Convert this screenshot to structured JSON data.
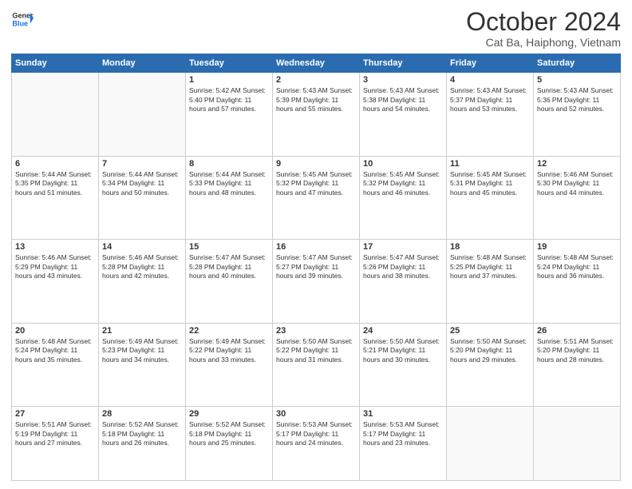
{
  "header": {
    "logo_general": "General",
    "logo_blue": "Blue",
    "month": "October 2024",
    "location": "Cat Ba, Haiphong, Vietnam"
  },
  "weekdays": [
    "Sunday",
    "Monday",
    "Tuesday",
    "Wednesday",
    "Thursday",
    "Friday",
    "Saturday"
  ],
  "weeks": [
    [
      {
        "day": "",
        "content": ""
      },
      {
        "day": "",
        "content": ""
      },
      {
        "day": "1",
        "content": "Sunrise: 5:42 AM\nSunset: 5:40 PM\nDaylight: 11 hours and 57 minutes."
      },
      {
        "day": "2",
        "content": "Sunrise: 5:43 AM\nSunset: 5:39 PM\nDaylight: 11 hours and 55 minutes."
      },
      {
        "day": "3",
        "content": "Sunrise: 5:43 AM\nSunset: 5:38 PM\nDaylight: 11 hours and 54 minutes."
      },
      {
        "day": "4",
        "content": "Sunrise: 5:43 AM\nSunset: 5:37 PM\nDaylight: 11 hours and 53 minutes."
      },
      {
        "day": "5",
        "content": "Sunrise: 5:43 AM\nSunset: 5:36 PM\nDaylight: 11 hours and 52 minutes."
      }
    ],
    [
      {
        "day": "6",
        "content": "Sunrise: 5:44 AM\nSunset: 5:35 PM\nDaylight: 11 hours and 51 minutes."
      },
      {
        "day": "7",
        "content": "Sunrise: 5:44 AM\nSunset: 5:34 PM\nDaylight: 11 hours and 50 minutes."
      },
      {
        "day": "8",
        "content": "Sunrise: 5:44 AM\nSunset: 5:33 PM\nDaylight: 11 hours and 48 minutes."
      },
      {
        "day": "9",
        "content": "Sunrise: 5:45 AM\nSunset: 5:32 PM\nDaylight: 11 hours and 47 minutes."
      },
      {
        "day": "10",
        "content": "Sunrise: 5:45 AM\nSunset: 5:32 PM\nDaylight: 11 hours and 46 minutes."
      },
      {
        "day": "11",
        "content": "Sunrise: 5:45 AM\nSunset: 5:31 PM\nDaylight: 11 hours and 45 minutes."
      },
      {
        "day": "12",
        "content": "Sunrise: 5:46 AM\nSunset: 5:30 PM\nDaylight: 11 hours and 44 minutes."
      }
    ],
    [
      {
        "day": "13",
        "content": "Sunrise: 5:46 AM\nSunset: 5:29 PM\nDaylight: 11 hours and 43 minutes."
      },
      {
        "day": "14",
        "content": "Sunrise: 5:46 AM\nSunset: 5:28 PM\nDaylight: 11 hours and 42 minutes."
      },
      {
        "day": "15",
        "content": "Sunrise: 5:47 AM\nSunset: 5:28 PM\nDaylight: 11 hours and 40 minutes."
      },
      {
        "day": "16",
        "content": "Sunrise: 5:47 AM\nSunset: 5:27 PM\nDaylight: 11 hours and 39 minutes."
      },
      {
        "day": "17",
        "content": "Sunrise: 5:47 AM\nSunset: 5:26 PM\nDaylight: 11 hours and 38 minutes."
      },
      {
        "day": "18",
        "content": "Sunrise: 5:48 AM\nSunset: 5:25 PM\nDaylight: 11 hours and 37 minutes."
      },
      {
        "day": "19",
        "content": "Sunrise: 5:48 AM\nSunset: 5:24 PM\nDaylight: 11 hours and 36 minutes."
      }
    ],
    [
      {
        "day": "20",
        "content": "Sunrise: 5:48 AM\nSunset: 5:24 PM\nDaylight: 11 hours and 35 minutes."
      },
      {
        "day": "21",
        "content": "Sunrise: 5:49 AM\nSunset: 5:23 PM\nDaylight: 11 hours and 34 minutes."
      },
      {
        "day": "22",
        "content": "Sunrise: 5:49 AM\nSunset: 5:22 PM\nDaylight: 11 hours and 33 minutes."
      },
      {
        "day": "23",
        "content": "Sunrise: 5:50 AM\nSunset: 5:22 PM\nDaylight: 11 hours and 31 minutes."
      },
      {
        "day": "24",
        "content": "Sunrise: 5:50 AM\nSunset: 5:21 PM\nDaylight: 11 hours and 30 minutes."
      },
      {
        "day": "25",
        "content": "Sunrise: 5:50 AM\nSunset: 5:20 PM\nDaylight: 11 hours and 29 minutes."
      },
      {
        "day": "26",
        "content": "Sunrise: 5:51 AM\nSunset: 5:20 PM\nDaylight: 11 hours and 28 minutes."
      }
    ],
    [
      {
        "day": "27",
        "content": "Sunrise: 5:51 AM\nSunset: 5:19 PM\nDaylight: 11 hours and 27 minutes."
      },
      {
        "day": "28",
        "content": "Sunrise: 5:52 AM\nSunset: 5:18 PM\nDaylight: 11 hours and 26 minutes."
      },
      {
        "day": "29",
        "content": "Sunrise: 5:52 AM\nSunset: 5:18 PM\nDaylight: 11 hours and 25 minutes."
      },
      {
        "day": "30",
        "content": "Sunrise: 5:53 AM\nSunset: 5:17 PM\nDaylight: 11 hours and 24 minutes."
      },
      {
        "day": "31",
        "content": "Sunrise: 5:53 AM\nSunset: 5:17 PM\nDaylight: 11 hours and 23 minutes."
      },
      {
        "day": "",
        "content": ""
      },
      {
        "day": "",
        "content": ""
      }
    ]
  ]
}
